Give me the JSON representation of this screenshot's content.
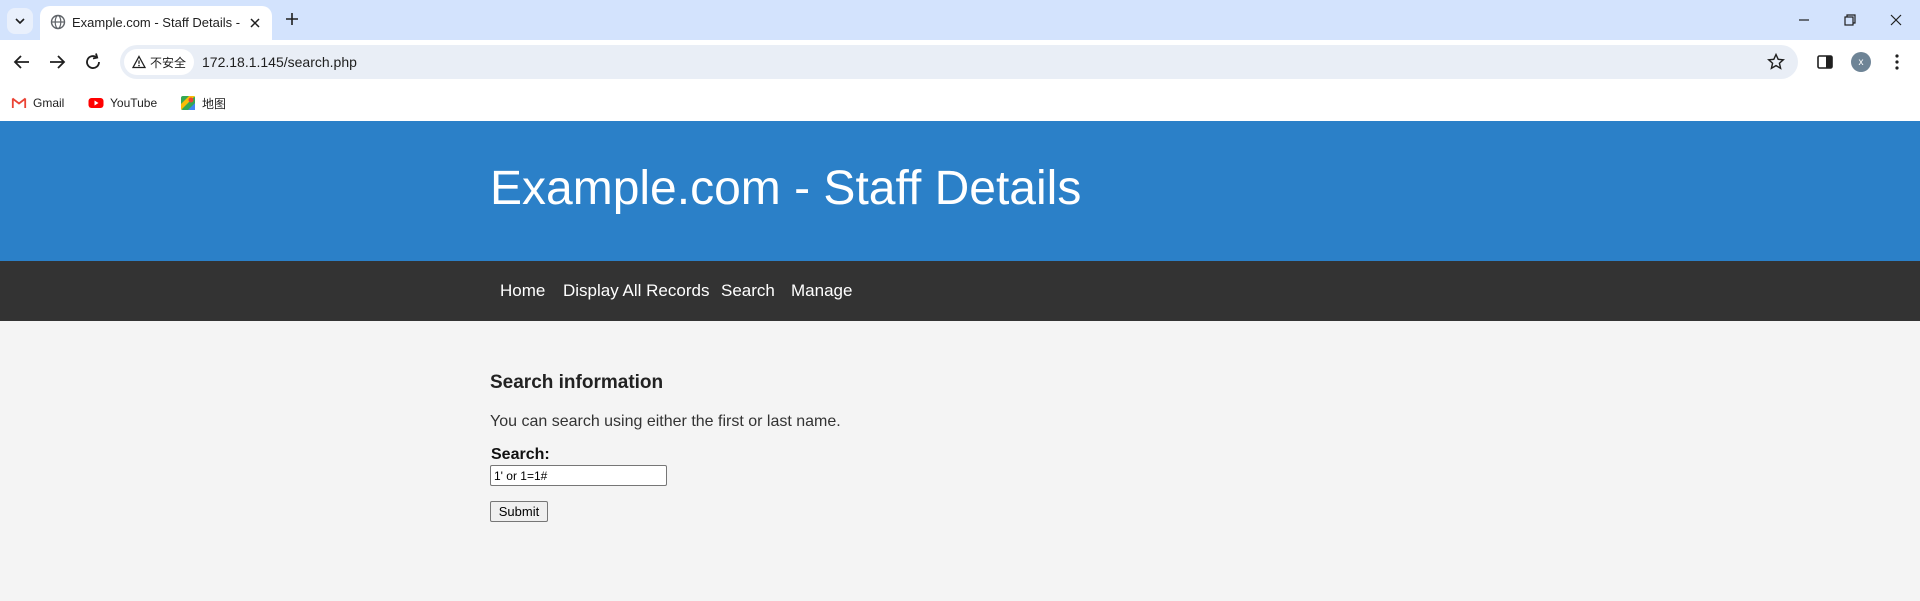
{
  "browser": {
    "tab": {
      "title": "Example.com - Staff Details - ",
      "favicon": "globe-icon"
    },
    "address_bar": {
      "security_label": "不安全",
      "url": "172.18.1.145/search.php"
    },
    "profile_initial": "x",
    "bookmarks": [
      {
        "label": "Gmail",
        "icon": "gmail-icon"
      },
      {
        "label": "YouTube",
        "icon": "youtube-icon"
      },
      {
        "label": "地图",
        "icon": "maps-icon"
      }
    ]
  },
  "site": {
    "title": "Example.com - Staff Details",
    "nav": [
      "Home",
      "Display All Records",
      "Search",
      "Manage"
    ],
    "colors": {
      "header": "#2b80c8",
      "nav": "#333333",
      "background": "#f4f4f4"
    }
  },
  "main": {
    "heading": "Search information",
    "intro": "You can search using either the first or last name.",
    "form": {
      "label": "Search:",
      "value": "1' or 1=1#",
      "submit_label": "Submit"
    }
  }
}
